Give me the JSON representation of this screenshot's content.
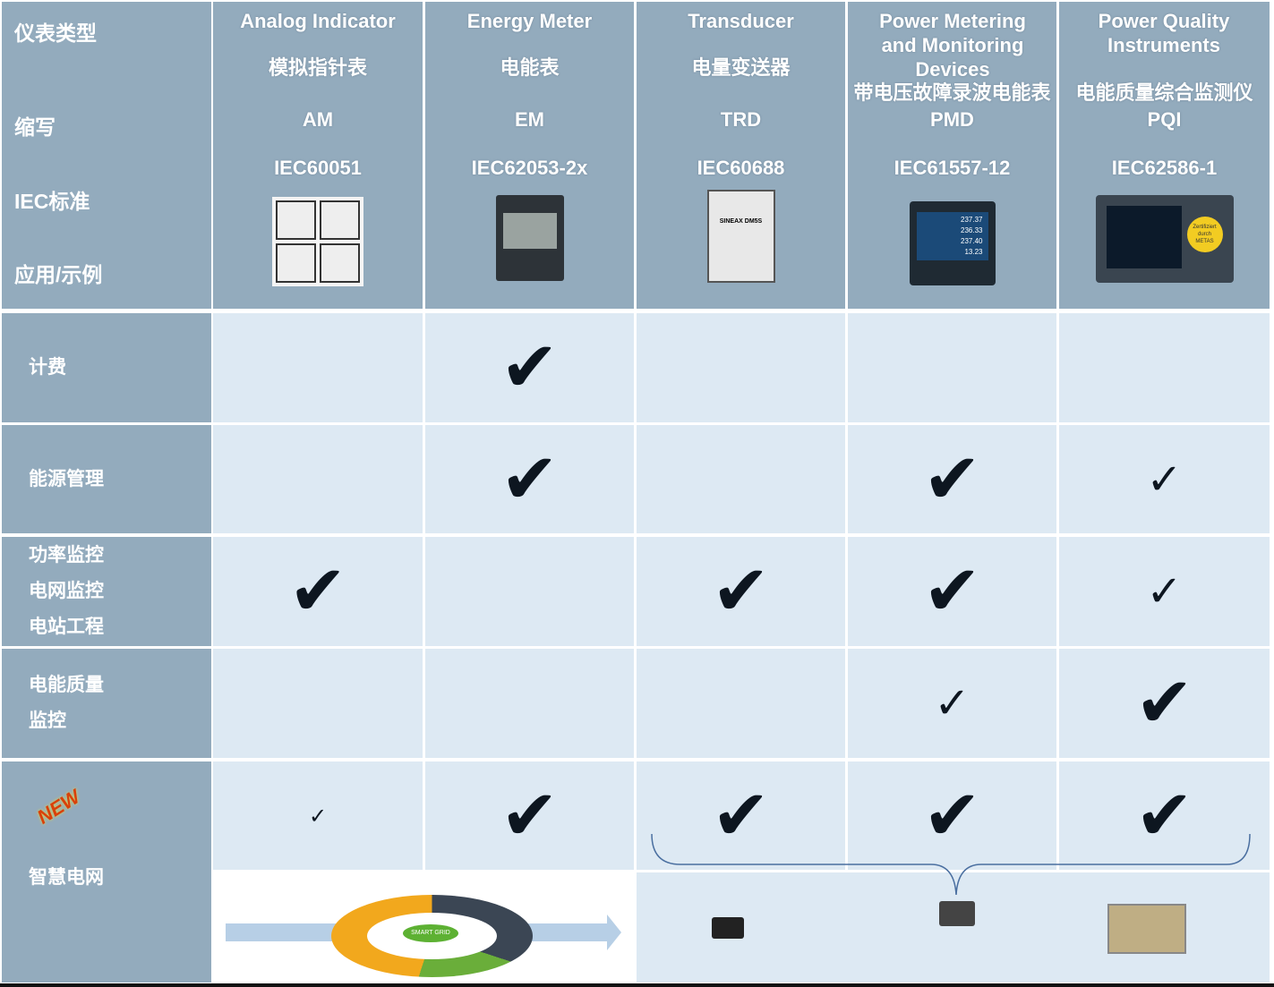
{
  "header": {
    "row_labels": [
      "仪表类型",
      "缩写",
      "IEC标准",
      "应用/示例"
    ],
    "columns": [
      {
        "en": "Analog Indicator",
        "zh": "模拟指针表",
        "abbr": "AM",
        "iec": "IEC60051"
      },
      {
        "en": "Energy Meter",
        "zh": "电能表",
        "abbr": "EM",
        "iec": "IEC62053-2x"
      },
      {
        "en": "Transducer",
        "zh": "电量变送器",
        "abbr": "TRD",
        "iec": "IEC60688"
      },
      {
        "en": "Power Metering and Monitoring Devices",
        "zh": "带电压故障录波电能表",
        "abbr": "PMD",
        "iec": "IEC61557-12"
      },
      {
        "en": "Power Quality Instruments",
        "zh": "电能质量综合监测仪",
        "abbr": "PQI",
        "iec": "IEC62586-1"
      }
    ]
  },
  "rows": [
    {
      "labels": [
        "计费"
      ],
      "checks": [
        "none",
        "large",
        "none",
        "none",
        "none"
      ]
    },
    {
      "labels": [
        "能源管理"
      ],
      "checks": [
        "none",
        "large",
        "none",
        "large",
        "small"
      ]
    },
    {
      "labels": [
        "功率监控",
        "电网监控",
        "电站工程"
      ],
      "checks": [
        "large",
        "none",
        "large",
        "large",
        "small"
      ]
    },
    {
      "labels": [
        "电能质量",
        "监控"
      ],
      "checks": [
        "none",
        "none",
        "none",
        "small",
        "large"
      ]
    },
    {
      "labels": [
        "智慧电网"
      ],
      "badge": "NEW",
      "checks": [
        "tiny",
        "large",
        "large",
        "large",
        "large"
      ]
    }
  ],
  "smart_grid_image_label": "SMART GRID",
  "device_texts": {
    "trd_label": "SINEAX DM5S",
    "pmd_values": [
      "237.37",
      "236.33",
      "237.40",
      "13.23"
    ],
    "pqi_badge": "Zertifiziert durch METAS"
  },
  "colors": {
    "header_bg": "#93abbd",
    "cell_bg": "#dde9f3",
    "check": "#0d1620",
    "new_badge": "#d9400a"
  }
}
